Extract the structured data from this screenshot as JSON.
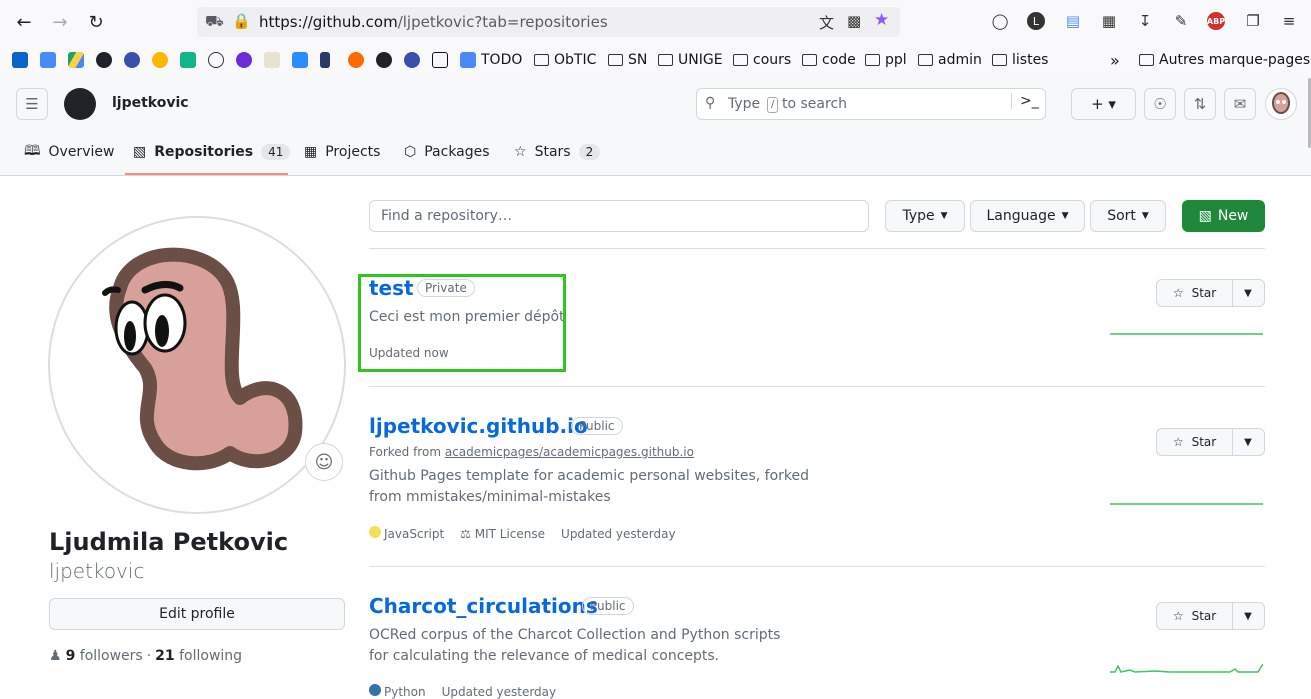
{
  "browser": {
    "url_host": "https://github.com",
    "url_path": "/ljpetkovic?tab=repositories",
    "bookmarks": {
      "items": [
        "TODO",
        "ObTIC",
        "SN",
        "UNIGE",
        "cours",
        "code",
        "ppl",
        "admin",
        "listes"
      ],
      "other": "Autres marque-pages"
    }
  },
  "header": {
    "username": "ljpetkovic",
    "search_placeholder_prefix": "Type",
    "search_key": "/",
    "search_placeholder_suffix": "to search"
  },
  "tabs": [
    {
      "label": "Overview",
      "count": ""
    },
    {
      "label": "Repositories",
      "count": "41"
    },
    {
      "label": "Projects",
      "count": ""
    },
    {
      "label": "Packages",
      "count": ""
    },
    {
      "label": "Stars",
      "count": "2"
    }
  ],
  "profile": {
    "name": "Ljudmila Petkovic",
    "login": "ljpetkovic",
    "edit_label": "Edit profile",
    "followers_count": "9",
    "followers_label": "followers",
    "separator": "·",
    "following_count": "21",
    "following_label": "following"
  },
  "filters": {
    "find_placeholder": "Find a repository…",
    "type_label": "Type",
    "language_label": "Language",
    "sort_label": "Sort",
    "new_label": "New"
  },
  "repos": [
    {
      "name": "test",
      "visibility": "Private",
      "description": "Ceci est mon premier dépôt",
      "updated": "Updated now",
      "star_label": "Star"
    },
    {
      "name": "ljpetkovic.github.io",
      "visibility": "Public",
      "forked_prefix": "Forked from",
      "forked_from": "academicpages/academicpages.github.io",
      "description": "Github Pages template for academic personal websites, forked from mmistakes/minimal-mistakes",
      "language": "JavaScript",
      "language_color": "#f1e05a",
      "license": "MIT License",
      "updated": "Updated yesterday",
      "star_label": "Star"
    },
    {
      "name": "Charcot_circulations",
      "visibility": "Public",
      "description": "OCRed corpus of the Charcot Collection and Python scripts for calculating the relevance of medical concepts.",
      "language": "Python",
      "language_color": "#3572A5",
      "updated": "Updated yesterday",
      "star_label": "Star"
    }
  ]
}
